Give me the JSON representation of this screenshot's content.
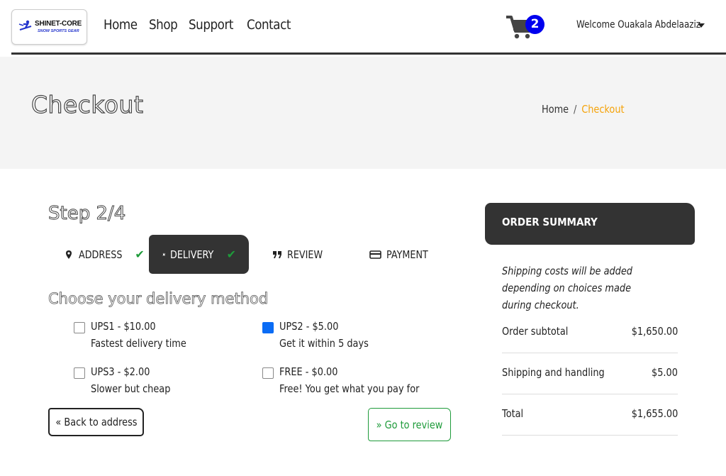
{
  "brand": {
    "logo_title": "SHINET-CORE",
    "logo_subtitle": "SNOW SPORTS GEAR"
  },
  "nav": {
    "links": [
      "Home",
      "Shop",
      "Support",
      "Contact"
    ]
  },
  "cart": {
    "count": "2"
  },
  "user": {
    "welcome": "Welcome Ouakala Abdelaaziz"
  },
  "hero": {
    "title": "Checkout",
    "breadcrumb": {
      "home": "Home",
      "separator": "/",
      "current": "Checkout"
    }
  },
  "step": {
    "title": "Step 2/4"
  },
  "tabs": [
    {
      "label": "ADDRESS",
      "icon": "map-marker-icon",
      "done": true
    },
    {
      "label": "DELIVERY",
      "icon": "plane-icon",
      "done": true,
      "active": true
    },
    {
      "label": "REVIEW",
      "icon": "quote-icon",
      "done": false
    },
    {
      "label": "PAYMENT",
      "icon": "credit-card-icon",
      "done": false
    }
  ],
  "delivery": {
    "title": "Choose your delivery method",
    "options": [
      {
        "title": "UPS1 - $10.00",
        "description": "Fastest delivery time",
        "checked": false
      },
      {
        "title": "UPS2 - $5.00",
        "description": "Get it within 5 days",
        "checked": true
      },
      {
        "title": "UPS3 - $2.00",
        "description": "Slower but cheap",
        "checked": false
      },
      {
        "title": "FREE - $0.00",
        "description": "Free! You get what you pay for",
        "checked": false
      }
    ]
  },
  "buttons": {
    "back": "« Back to address",
    "next": "» Go to review"
  },
  "summary": {
    "title": "ORDER SUMMARY",
    "note": "Shipping costs will be added depending on choices made during checkout.",
    "rows": [
      {
        "label": "Order subtotal",
        "value": "$1,650.00"
      },
      {
        "label": "Shipping and handling",
        "value": "$5.00"
      },
      {
        "label": "Total",
        "value": "$1,655.00"
      }
    ]
  },
  "colors": {
    "accent": "#f5a30a",
    "success": "#1e9b3a",
    "dark": "#333333",
    "badge": "#0000ee",
    "checkbox": "#0a6cf5"
  }
}
